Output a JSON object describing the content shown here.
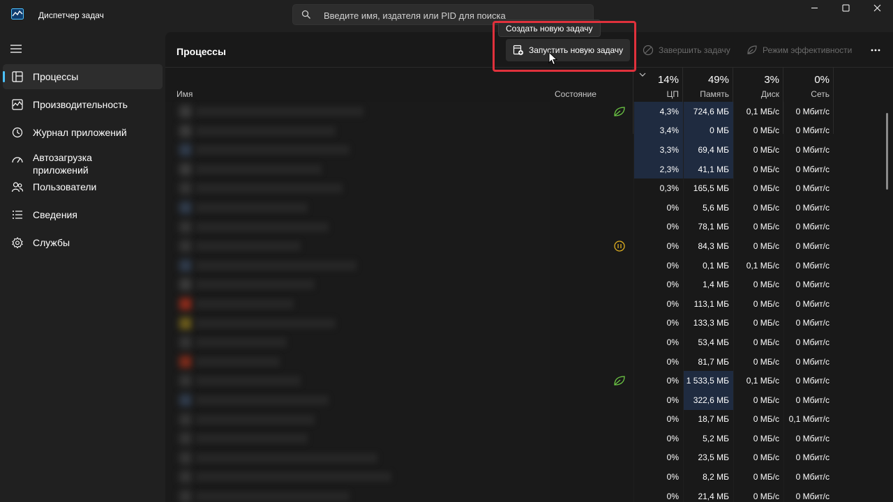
{
  "window": {
    "title": "Диспетчер задач",
    "accent": "#4cc2ff"
  },
  "search": {
    "placeholder": "Введите имя, издателя или PID для поиска"
  },
  "sidebar": {
    "items": [
      {
        "label": "Процессы",
        "icon": "processes-icon",
        "active": true
      },
      {
        "label": "Производительность",
        "icon": "performance-icon"
      },
      {
        "label": "Журнал приложений",
        "icon": "app-history-icon"
      },
      {
        "label": "Автозагрузка приложений",
        "icon": "startup-icon"
      },
      {
        "label": "Пользователи",
        "icon": "users-icon"
      },
      {
        "label": "Сведения",
        "icon": "details-icon"
      },
      {
        "label": "Службы",
        "icon": "services-icon"
      }
    ]
  },
  "main": {
    "title": "Процессы",
    "toolbar": {
      "run_label": "Запустить новую задачу",
      "end_label": "Завершить задачу",
      "efficiency_label": "Режим эффективности"
    },
    "tooltip": "Создать новую задачу",
    "columns": {
      "name": "Имя",
      "status": "Состояние",
      "cpu": {
        "pct": "14%",
        "label": "ЦП"
      },
      "memory": {
        "pct": "49%",
        "label": "Память"
      },
      "disk": {
        "pct": "3%",
        "label": "Диск"
      },
      "network": {
        "pct": "0%",
        "label": "Сеть"
      }
    },
    "rows": [
      {
        "status": "leaf",
        "cpu": "4,3%",
        "mem": "724,6 МБ",
        "disk": "0,1 МБ/с",
        "net": "0 Мбит/с"
      },
      {
        "status": "",
        "cpu": "3,4%",
        "mem": "0 МБ",
        "disk": "0 МБ/с",
        "net": "0 Мбит/с"
      },
      {
        "status": "",
        "cpu": "3,3%",
        "mem": "69,4 МБ",
        "disk": "0 МБ/с",
        "net": "0 Мбит/с"
      },
      {
        "status": "",
        "cpu": "2,3%",
        "mem": "41,1 МБ",
        "disk": "0 МБ/с",
        "net": "0 Мбит/с"
      },
      {
        "status": "",
        "cpu": "0,3%",
        "mem": "165,5 МБ",
        "disk": "0 МБ/с",
        "net": "0 Мбит/с"
      },
      {
        "status": "",
        "cpu": "0%",
        "mem": "5,6 МБ",
        "disk": "0 МБ/с",
        "net": "0 Мбит/с"
      },
      {
        "status": "",
        "cpu": "0%",
        "mem": "78,1 МБ",
        "disk": "0 МБ/с",
        "net": "0 Мбит/с"
      },
      {
        "status": "paused",
        "cpu": "0%",
        "mem": "84,3 МБ",
        "disk": "0 МБ/с",
        "net": "0 Мбит/с"
      },
      {
        "status": "",
        "cpu": "0%",
        "mem": "0,1 МБ",
        "disk": "0,1 МБ/с",
        "net": "0 Мбит/с"
      },
      {
        "status": "",
        "cpu": "0%",
        "mem": "1,4 МБ",
        "disk": "0 МБ/с",
        "net": "0 Мбит/с"
      },
      {
        "status": "",
        "cpu": "0%",
        "mem": "113,1 МБ",
        "disk": "0 МБ/с",
        "net": "0 Мбит/с"
      },
      {
        "status": "",
        "cpu": "0%",
        "mem": "133,3 МБ",
        "disk": "0 МБ/с",
        "net": "0 Мбит/с"
      },
      {
        "status": "",
        "cpu": "0%",
        "mem": "53,4 МБ",
        "disk": "0 МБ/с",
        "net": "0 Мбит/с"
      },
      {
        "status": "",
        "cpu": "0%",
        "mem": "81,7 МБ",
        "disk": "0 МБ/с",
        "net": "0 Мбит/с"
      },
      {
        "status": "leaf",
        "cpu": "0%",
        "mem": "1 533,5 МБ",
        "disk": "0,1 МБ/с",
        "net": "0 Мбит/с"
      },
      {
        "status": "",
        "cpu": "0%",
        "mem": "322,6 МБ",
        "disk": "0 МБ/с",
        "net": "0 Мбит/с"
      },
      {
        "status": "",
        "cpu": "0%",
        "mem": "18,7 МБ",
        "disk": "0 МБ/с",
        "net": "0,1 Мбит/с"
      },
      {
        "status": "",
        "cpu": "0%",
        "mem": "5,2 МБ",
        "disk": "0 МБ/с",
        "net": "0 Мбит/с"
      },
      {
        "status": "",
        "cpu": "0%",
        "mem": "23,5 МБ",
        "disk": "0 МБ/с",
        "net": "0 Мбит/с"
      },
      {
        "status": "",
        "cpu": "0%",
        "mem": "8,2 МБ",
        "disk": "0 МБ/с",
        "net": "0 Мбит/с"
      },
      {
        "status": "",
        "cpu": "0%",
        "mem": "21,4 МБ",
        "disk": "0 МБ/с",
        "net": "0 Мбит/с"
      }
    ]
  }
}
